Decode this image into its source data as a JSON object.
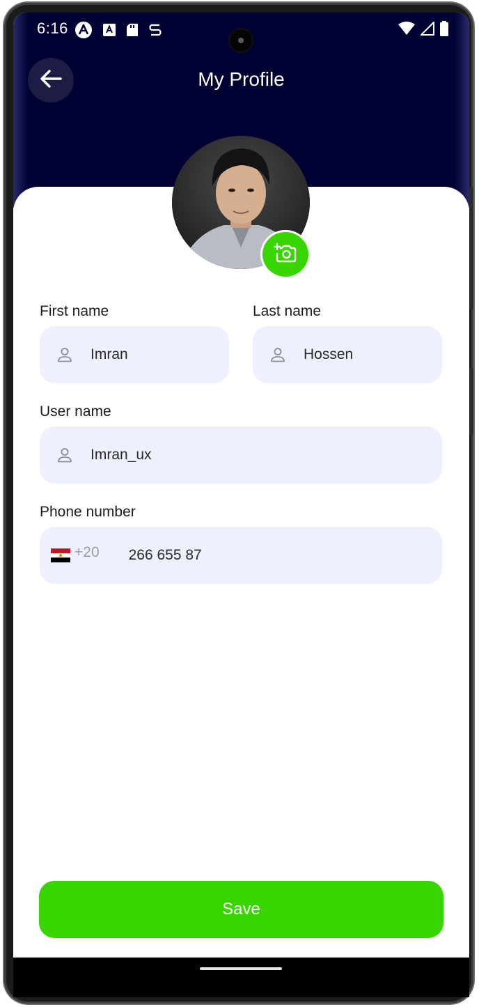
{
  "status_bar": {
    "time": "6:16",
    "left_icons": [
      "a-circle-icon",
      "a-box-icon",
      "sd-card-icon",
      "sync-icon"
    ],
    "right_icons": [
      "wifi-icon",
      "signal-icon",
      "battery-icon"
    ]
  },
  "header": {
    "title": "My Profile",
    "back_icon": "arrow-left-icon",
    "background_color": "#000033"
  },
  "avatar": {
    "badge_icon": "add-camera-icon",
    "badge_color": "#38d500"
  },
  "form": {
    "first_name": {
      "label": "First name",
      "value": "Imran",
      "icon": "user-icon"
    },
    "last_name": {
      "label": "Last name",
      "value": "Hossen",
      "icon": "user-icon"
    },
    "user_name": {
      "label": "User name",
      "value": "Imran_ux",
      "icon": "user-icon"
    },
    "phone": {
      "label": "Phone number",
      "flag": "🇪🇬",
      "country_code": "+20",
      "value": "266 655 87"
    }
  },
  "actions": {
    "save_label": "Save",
    "accent_color": "#38d500"
  }
}
